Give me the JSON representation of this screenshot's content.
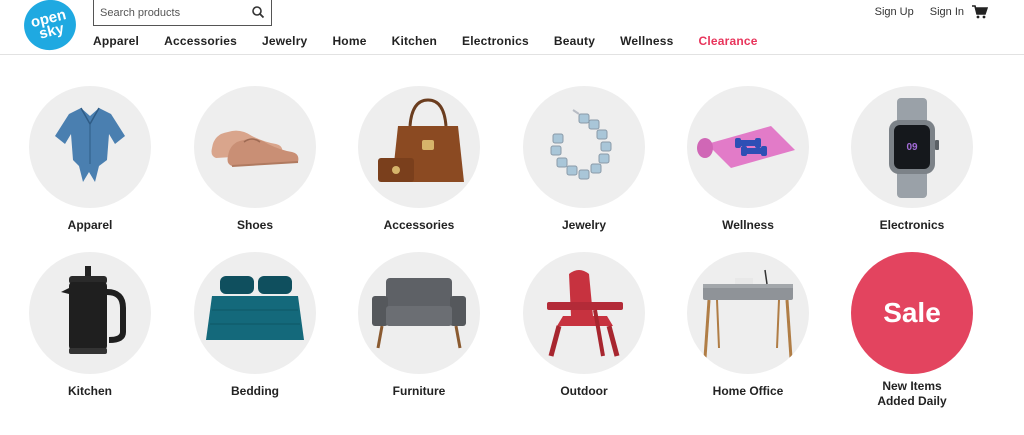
{
  "logo": {
    "line1": "open",
    "line2": "sky",
    "color": "#1fa9e1"
  },
  "search": {
    "placeholder": "Search products",
    "value": ""
  },
  "nav": [
    {
      "label": "Apparel"
    },
    {
      "label": "Accessories"
    },
    {
      "label": "Jewelry"
    },
    {
      "label": "Home"
    },
    {
      "label": "Kitchen"
    },
    {
      "label": "Electronics"
    },
    {
      "label": "Beauty"
    },
    {
      "label": "Wellness"
    },
    {
      "label": "Clearance",
      "color": "#e8345b"
    }
  ],
  "account": {
    "sign_up": "Sign Up",
    "sign_in": "Sign In",
    "cart_icon": "cart-icon"
  },
  "categories_row1": [
    {
      "label": "Apparel",
      "icon": "shirt-image"
    },
    {
      "label": "Shoes",
      "icon": "shoes-image"
    },
    {
      "label": "Accessories",
      "icon": "handbag-image"
    },
    {
      "label": "Jewelry",
      "icon": "bracelet-image"
    },
    {
      "label": "Wellness",
      "icon": "yoga-mat-image"
    },
    {
      "label": "Electronics",
      "icon": "smartwatch-image"
    }
  ],
  "categories_row2": [
    {
      "label": "Kitchen",
      "icon": "french-press-image"
    },
    {
      "label": "Bedding",
      "icon": "comforter-image"
    },
    {
      "label": "Furniture",
      "icon": "loveseat-image"
    },
    {
      "label": "Outdoor",
      "icon": "adirondack-chair-image"
    },
    {
      "label": "Home Office",
      "icon": "desk-image"
    }
  ],
  "sale": {
    "badge": "Sale",
    "line1": "New Items",
    "line2": "Added Daily",
    "color": "#e3445f"
  }
}
